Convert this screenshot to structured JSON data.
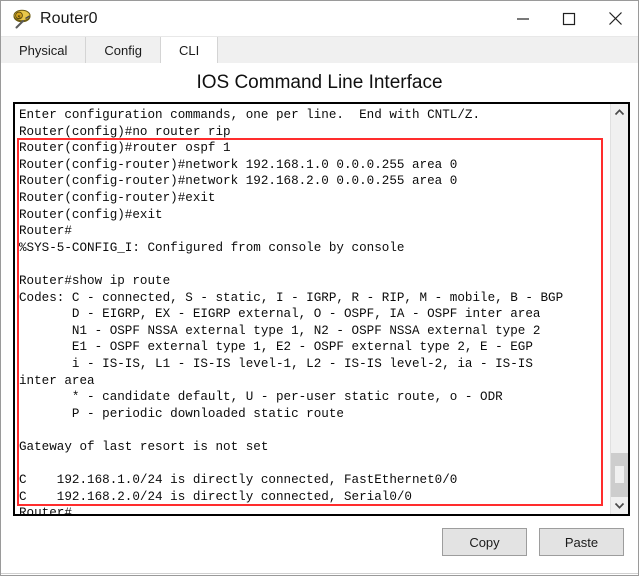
{
  "window": {
    "title": "Router0",
    "icon": "router-icon",
    "controls": {
      "minimize": "minimize-icon",
      "maximize": "maximize-icon",
      "close": "close-icon"
    }
  },
  "tabs": [
    {
      "label": "Physical",
      "active": false
    },
    {
      "label": "Config",
      "active": false
    },
    {
      "label": "CLI",
      "active": true
    }
  ],
  "heading": "IOS Command Line Interface",
  "terminal": {
    "lines": [
      "Enter configuration commands, one per line.  End with CNTL/Z.",
      "Router(config)#no router rip",
      "Router(config)#router ospf 1",
      "Router(config-router)#network 192.168.1.0 0.0.0.255 area 0",
      "Router(config-router)#network 192.168.2.0 0.0.0.255 area 0",
      "Router(config-router)#exit",
      "Router(config)#exit",
      "Router#",
      "%SYS-5-CONFIG_I: Configured from console by console",
      "",
      "Router#show ip route",
      "Codes: C - connected, S - static, I - IGRP, R - RIP, M - mobile, B - BGP",
      "       D - EIGRP, EX - EIGRP external, O - OSPF, IA - OSPF inter area",
      "       N1 - OSPF NSSA external type 1, N2 - OSPF NSSA external type 2",
      "       E1 - OSPF external type 1, E2 - OSPF external type 2, E - EGP",
      "       i - IS-IS, L1 - IS-IS level-1, L2 - IS-IS level-2, ia - IS-IS",
      "inter area",
      "       * - candidate default, U - per-user static route, o - ODR",
      "       P - periodic downloaded static route",
      "",
      "Gateway of last resort is not set",
      "",
      "C    192.168.1.0/24 is directly connected, FastEthernet0/0",
      "C    192.168.2.0/24 is directly connected, Serial0/0",
      "Router#"
    ],
    "highlight_color": "#ff2d2d",
    "highlight_start_line": 2,
    "highlight_end_line": 23
  },
  "scrollbar": {
    "up_arrow": "chevron-up-icon",
    "down_arrow": "chevron-down-icon"
  },
  "footer": {
    "copy_label": "Copy",
    "paste_label": "Paste"
  }
}
